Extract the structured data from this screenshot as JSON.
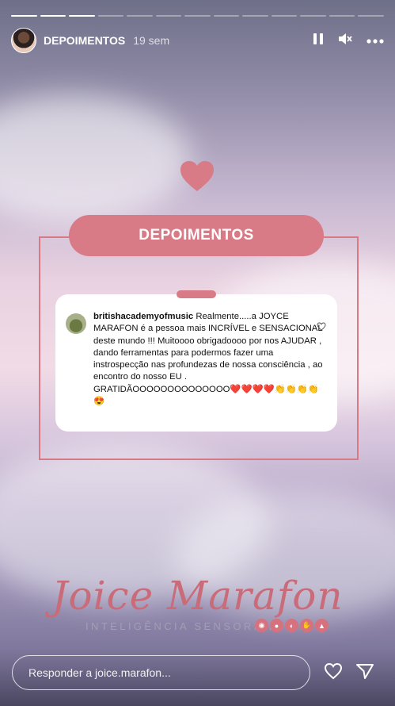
{
  "progress": {
    "total": 13,
    "done": 3
  },
  "header": {
    "username": "DEPOIMENTOS",
    "time": "19 sem"
  },
  "title": {
    "label": "DEPOIMENTOS"
  },
  "comment": {
    "username": "britishacademyofmusic",
    "text": " Realmente.....a JOYCE MARAFON é a pessoa mais INCRÍVEL e SENSACIONAL deste mundo !!! Muitoooo obrigadoooo por nos AJUDAR ,  dando ferramentas para podermos fazer uma instrospecção nas profundezas de nossa consciência , ao encontro do nosso EU . GRATIDÃOOOOOOOOOOOOOO❤️❤️❤️❤️👏👏👏👏😍"
  },
  "logo": {
    "name": "Joice Marafon",
    "tagline": "INTELIGÊNCIA SENSORIAL"
  },
  "reply": {
    "placeholder": "Responder a joice.marafon..."
  },
  "colors": {
    "accent": "#d97b87",
    "frame": "#d87986"
  }
}
